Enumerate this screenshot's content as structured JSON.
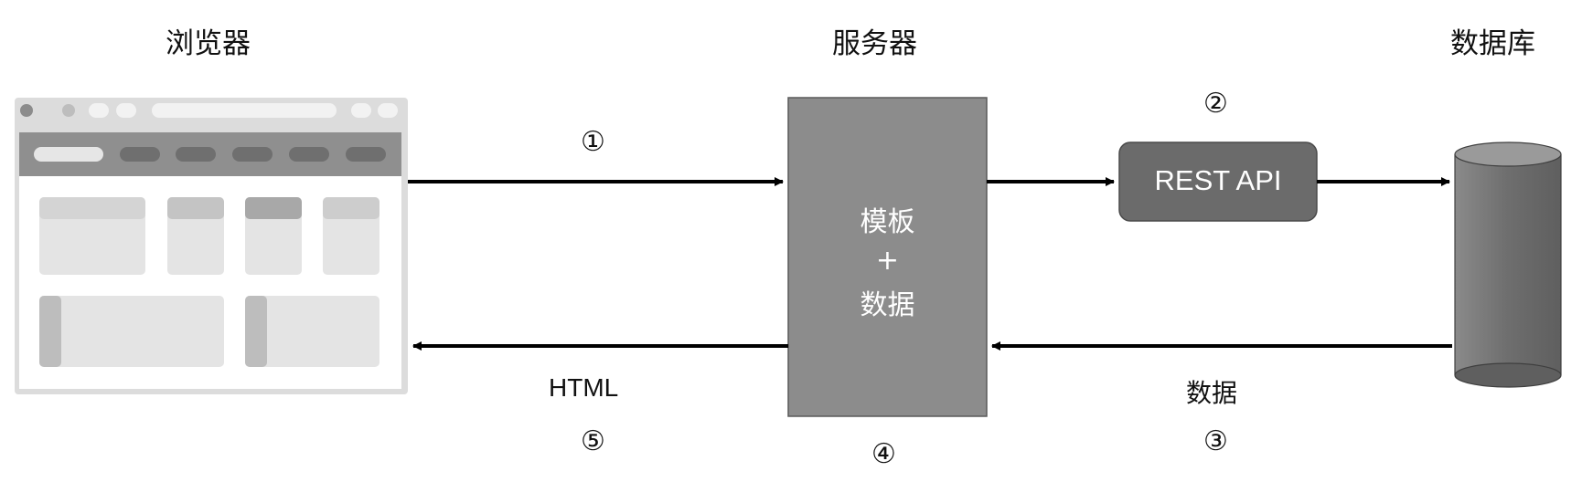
{
  "columns": {
    "browser": "浏览器",
    "server": "服务器",
    "database": "数据库"
  },
  "server_box": {
    "line1": "模板",
    "line2": "+",
    "line3": "数据"
  },
  "api_box": {
    "label": "REST API"
  },
  "edge_labels": {
    "response_format": "HTML",
    "db_return": "数据"
  },
  "steps": {
    "step1": "①",
    "step2": "②",
    "step3": "③",
    "step4": "④",
    "step5": "⑤"
  },
  "colors": {
    "server_fill": "#8c8c8c",
    "api_fill": "#6b6b6b",
    "db_fill": "#777777",
    "arrow": "#000000"
  }
}
